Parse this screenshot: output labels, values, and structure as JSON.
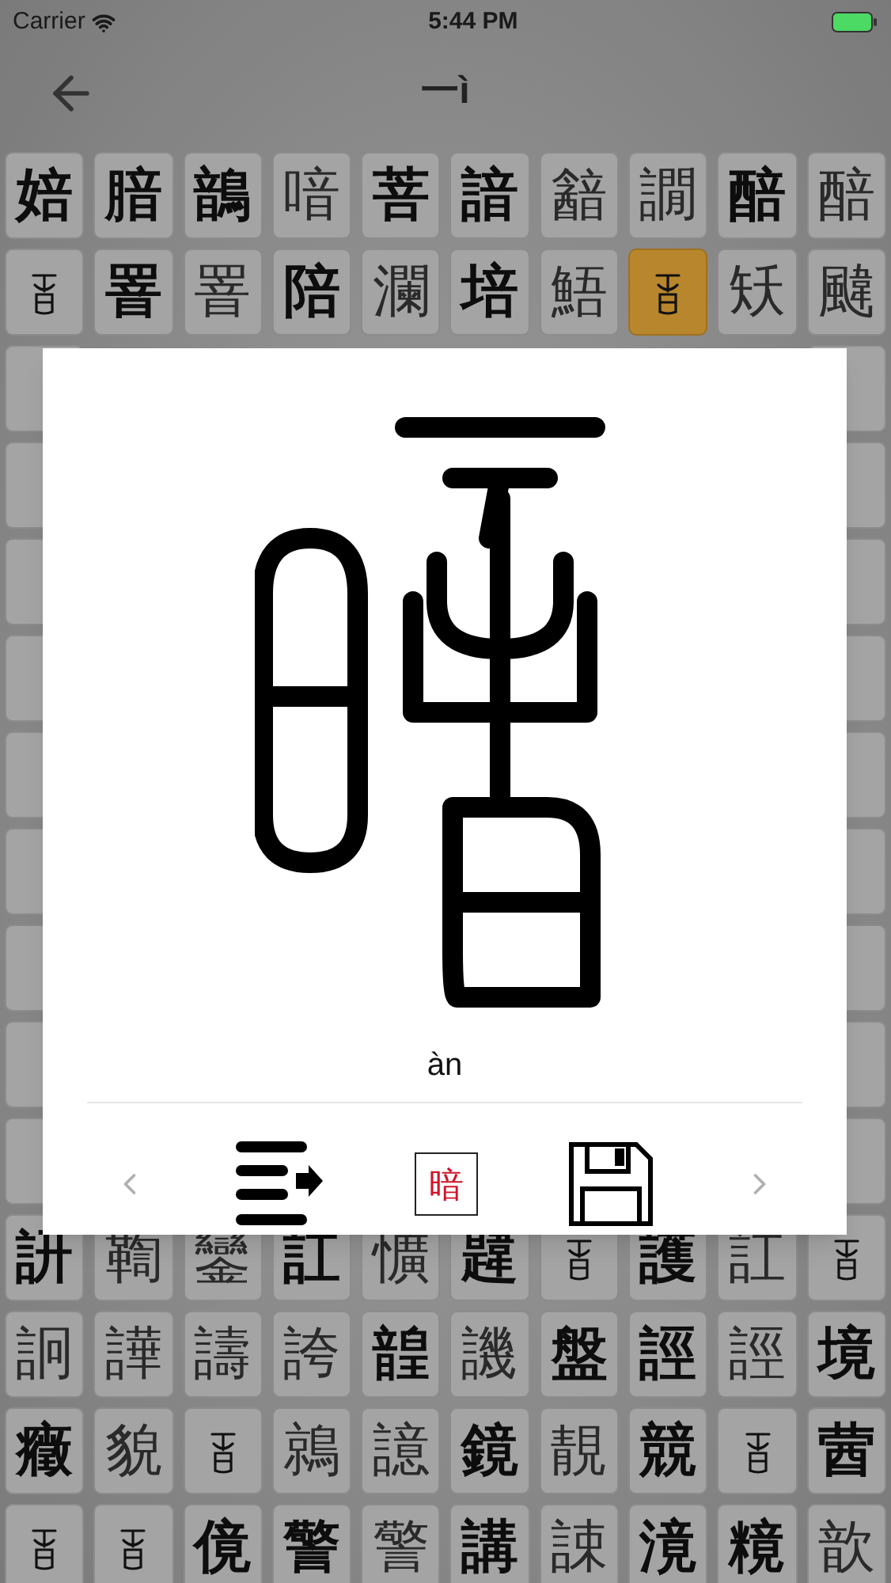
{
  "status_bar": {
    "carrier": "Carrier",
    "time": "5:44 PM"
  },
  "nav": {
    "title": "一ì"
  },
  "grid": {
    "top_rows": [
      [
        {
          "char": "婄",
          "kind": "bold",
          "selected": false
        },
        {
          "char": "腤",
          "kind": "bold",
          "selected": false
        },
        {
          "char": "鶕",
          "kind": "bold",
          "selected": false
        },
        {
          "char": "喑",
          "kind": "light",
          "selected": false
        },
        {
          "char": "菩",
          "kind": "bold",
          "selected": false
        },
        {
          "char": "諳",
          "kind": "bold",
          "selected": false
        },
        {
          "char": "韽",
          "kind": "light",
          "selected": false
        },
        {
          "char": "譋",
          "kind": "light",
          "selected": false
        },
        {
          "char": "醅",
          "kind": "bold",
          "selected": false
        },
        {
          "char": "醅",
          "kind": "light",
          "selected": false
        }
      ],
      [
        {
          "kind": "seal",
          "selected": false
        },
        {
          "char": "罯",
          "kind": "bold",
          "selected": false
        },
        {
          "char": "罯",
          "kind": "light",
          "selected": false
        },
        {
          "char": "陪",
          "kind": "bold",
          "selected": false
        },
        {
          "char": "瀾",
          "kind": "light",
          "selected": false
        },
        {
          "char": "培",
          "kind": "bold",
          "selected": false
        },
        {
          "char": "鯃",
          "kind": "light",
          "selected": false
        },
        {
          "kind": "seal",
          "selected": true
        },
        {
          "char": "矨",
          "kind": "light",
          "selected": false
        },
        {
          "char": "颹",
          "kind": "light",
          "selected": false
        }
      ]
    ],
    "bottom_rows": [
      [
        {
          "char": "訮",
          "kind": "bold",
          "selected": false
        },
        {
          "char": "鞫",
          "kind": "light",
          "selected": false
        },
        {
          "char": "鑾",
          "kind": "light",
          "selected": false
        },
        {
          "char": "訌",
          "kind": "bold",
          "selected": false
        },
        {
          "char": "懭",
          "kind": "light",
          "selected": false
        },
        {
          "char": "韙",
          "kind": "bold",
          "selected": false
        },
        {
          "kind": "seal",
          "selected": false
        },
        {
          "char": "護",
          "kind": "bold",
          "selected": false
        },
        {
          "char": "訌",
          "kind": "light",
          "selected": false
        },
        {
          "kind": "seal",
          "selected": false
        }
      ],
      [
        {
          "char": "詗",
          "kind": "light",
          "selected": false
        },
        {
          "char": "譁",
          "kind": "light",
          "selected": false
        },
        {
          "char": "譸",
          "kind": "light",
          "selected": false
        },
        {
          "char": "誇",
          "kind": "light",
          "selected": false
        },
        {
          "char": "韹",
          "kind": "bold",
          "selected": false
        },
        {
          "char": "譏",
          "kind": "light",
          "selected": false
        },
        {
          "char": "盤",
          "kind": "bold",
          "selected": false
        },
        {
          "char": "誙",
          "kind": "bold",
          "selected": false
        },
        {
          "char": "誙",
          "kind": "light",
          "selected": false
        },
        {
          "char": "境",
          "kind": "bold",
          "selected": false
        }
      ],
      [
        {
          "char": "癥",
          "kind": "bold",
          "selected": false
        },
        {
          "char": "貌",
          "kind": "light",
          "selected": false
        },
        {
          "kind": "seal",
          "selected": false
        },
        {
          "char": "鶁",
          "kind": "light",
          "selected": false
        },
        {
          "char": "譩",
          "kind": "light",
          "selected": false
        },
        {
          "char": "鏡",
          "kind": "bold",
          "selected": false
        },
        {
          "char": "靚",
          "kind": "light",
          "selected": false
        },
        {
          "char": "競",
          "kind": "bold",
          "selected": false
        },
        {
          "kind": "seal",
          "selected": false
        },
        {
          "char": "蒏",
          "kind": "bold",
          "selected": false
        }
      ],
      [
        {
          "kind": "seal",
          "selected": false
        },
        {
          "kind": "seal",
          "selected": false
        },
        {
          "char": "傹",
          "kind": "bold",
          "selected": false
        },
        {
          "char": "警",
          "kind": "bold",
          "selected": false
        },
        {
          "char": "警",
          "kind": "light",
          "selected": false
        },
        {
          "char": "講",
          "kind": "bold",
          "selected": false
        },
        {
          "char": "誎",
          "kind": "light",
          "selected": false
        },
        {
          "char": "滰",
          "kind": "bold",
          "selected": false
        },
        {
          "char": "糡",
          "kind": "bold",
          "selected": false
        },
        {
          "char": "歆",
          "kind": "light",
          "selected": false
        }
      ]
    ]
  },
  "dialog": {
    "pinyin": "àn",
    "glyph_button": "暗"
  }
}
